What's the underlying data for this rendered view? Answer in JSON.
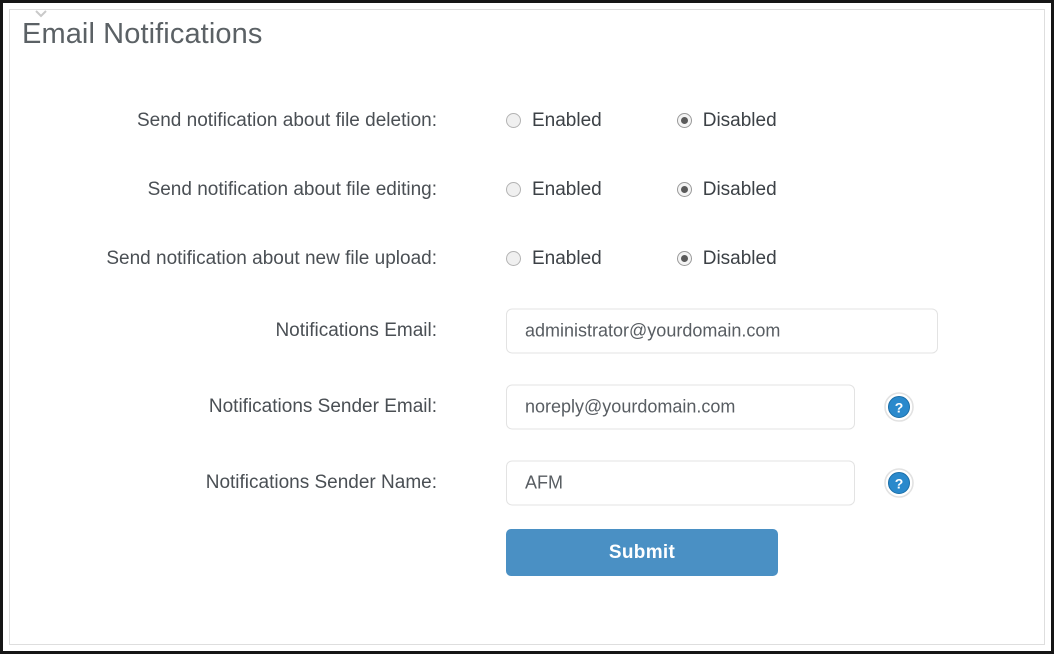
{
  "page": {
    "title": "Email Notifications"
  },
  "radio_options": {
    "enabled_label": "Enabled",
    "disabled_label": "Disabled"
  },
  "rows": [
    {
      "label": "Send notification about file deletion:",
      "type": "radio",
      "enabled_label": "Enabled",
      "disabled_label": "Disabled",
      "selected": "Disabled"
    },
    {
      "label": "Send notification about file editing:",
      "type": "radio",
      "enabled_label": "Enabled",
      "disabled_label": "Disabled",
      "selected": "Disabled"
    },
    {
      "label": "Send notification about new file upload:",
      "type": "radio",
      "enabled_label": "Enabled",
      "disabled_label": "Disabled",
      "selected": "Disabled"
    },
    {
      "label": "Notifications Email:",
      "type": "text",
      "value": "administrator@yourdomain.com",
      "placeholder": "",
      "help": false
    },
    {
      "label": "Notifications Sender Email:",
      "type": "text",
      "value": "noreply@yourdomain.com",
      "placeholder": "",
      "help": true
    },
    {
      "label": "Notifications Sender Name:",
      "type": "text",
      "value": "AFM",
      "placeholder": "",
      "help": true
    }
  ],
  "submit": {
    "label": "Submit"
  },
  "icons": {
    "help": "help-circle-icon",
    "chevron": "chevron-down-icon"
  },
  "colors": {
    "accent_blue": "#4a90c4",
    "help_icon_blue": "#2a89cc",
    "title_gray": "#5b6165",
    "label_gray": "#4a4f54",
    "input_border": "#e3e3e3",
    "frame_dark": "#161616",
    "panel_border": "#dedede"
  }
}
